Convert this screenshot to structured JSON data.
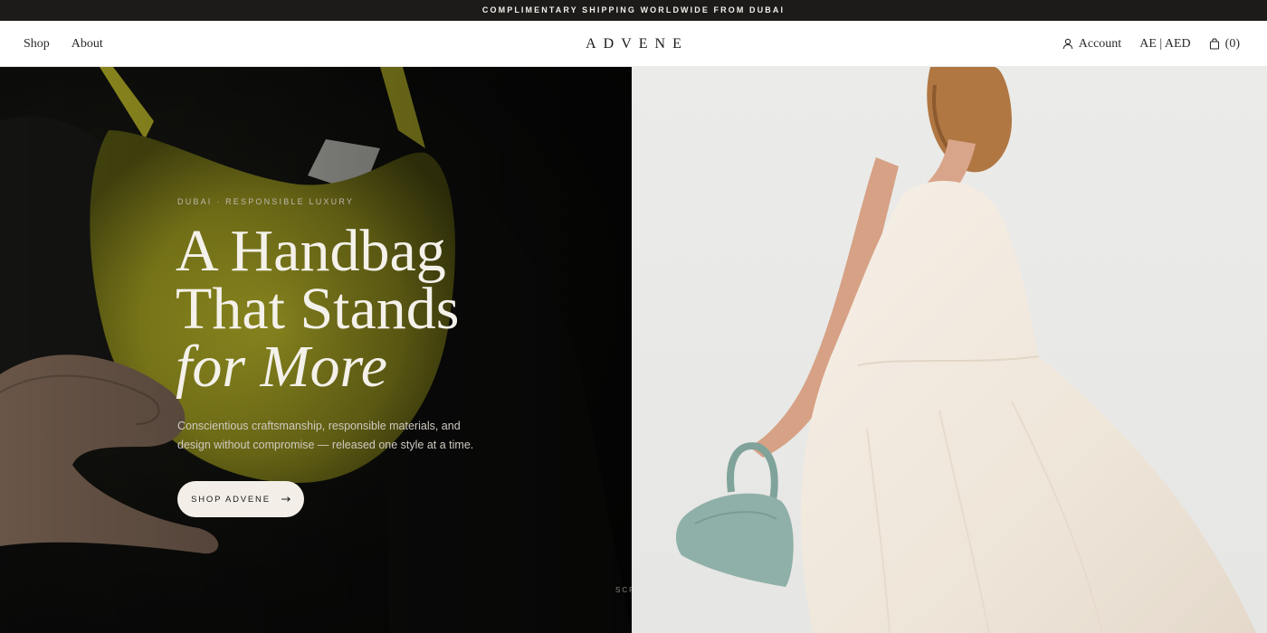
{
  "announcement": "COMPLIMENTARY SHIPPING WORLDWIDE FROM DUBAI",
  "header": {
    "logo": "ADVENE",
    "nav_left": [
      {
        "label": "Shop"
      },
      {
        "label": "About"
      }
    ],
    "account_label": "Account",
    "locale_label": "AE | AED",
    "cart_label": "(0)",
    "icons": {
      "account": "user-icon",
      "cart": "bag-icon"
    }
  },
  "hero": {
    "eyebrow": "DUBAI · RESPONSIBLE LUXURY",
    "headline": {
      "line1": "A Handbag",
      "line2": "That Stands",
      "line3": "for More"
    },
    "subcopy": "Conscientious craftsmanship, responsible materials, and design without compromise — released one style at a time.",
    "cta_label": "SHOP ADVENE",
    "cta_icon": "arrow-right-icon",
    "scroll_hint": "SCROLL",
    "colors": {
      "bag_left": "#b9b52a",
      "bag_right": "#8fb0a8",
      "dress": "#f1e9de",
      "background_left": "#0b0b0a",
      "background_right": "#e8e8e6"
    }
  }
}
